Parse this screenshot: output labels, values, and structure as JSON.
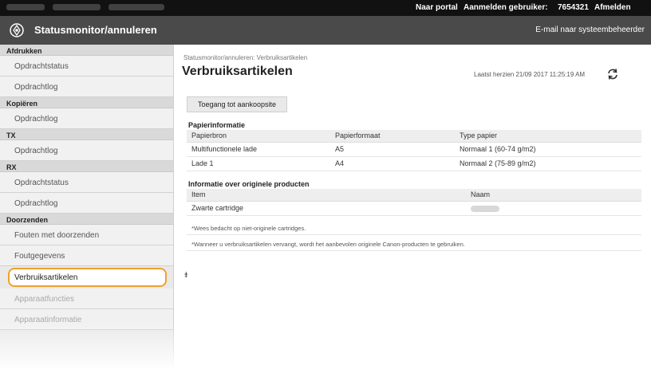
{
  "topbar": {
    "portal": "Naar portal",
    "user_label": "Aanmelden gebruiker:",
    "user_id": "7654321",
    "logout": "Afmelden"
  },
  "header": {
    "title": "Statusmonitor/annuleren",
    "mail": "E-mail naar systeembeheerder"
  },
  "sidebar": {
    "sections": [
      {
        "title": "Afdrukken",
        "items": [
          "Opdrachtstatus",
          "Opdrachtlog"
        ]
      },
      {
        "title": "Kopiëren",
        "items": [
          "Opdrachtlog"
        ]
      },
      {
        "title": "TX",
        "items": [
          "Opdrachtlog"
        ]
      },
      {
        "title": "RX",
        "items": [
          "Opdrachtstatus",
          "Opdrachtlog"
        ]
      },
      {
        "title": "Doorzenden",
        "items": [
          "Fouten met doorzenden",
          "Foutgegevens"
        ]
      }
    ],
    "active_item": "Verbruiksartikelen",
    "after_items": [
      "Apparaatfuncties",
      "Apparaatinformatie"
    ]
  },
  "main": {
    "breadcrumb": "Statusmonitor/annuleren: Verbruiksartikelen",
    "title": "Verbruiksartikelen",
    "updated": "Laatst herzien 21/09 2017 11:25:19 AM",
    "shop_button": "Toegang tot aankoopsite",
    "paper": {
      "heading": "Papierinformatie",
      "headers": [
        "Papierbron",
        "Papierformaat",
        "Type papier"
      ],
      "rows": [
        [
          "Multifunctionele lade",
          "A5",
          "Normaal 1 (60-74 g/m2)"
        ],
        [
          "Lade 1",
          "A4",
          "Normaal 2 (75-89 g/m2)"
        ]
      ]
    },
    "products": {
      "heading": "Informatie over originele producten",
      "headers": [
        "Item",
        "Naam"
      ],
      "rows": [
        [
          "Zwarte cartridge",
          ""
        ]
      ]
    },
    "note1": "*Wees bedacht op niet-originele cartridges.",
    "note2": "*Wanneer u verbruiksartikelen vervangt, wordt het aanbevolen originele Canon-producten te gebruiken.",
    "top_link": "⯒"
  },
  "colors": {
    "active_outline": "#f0a030",
    "header_bg": "#4a4a4a",
    "topbar_bg": "#111111"
  }
}
